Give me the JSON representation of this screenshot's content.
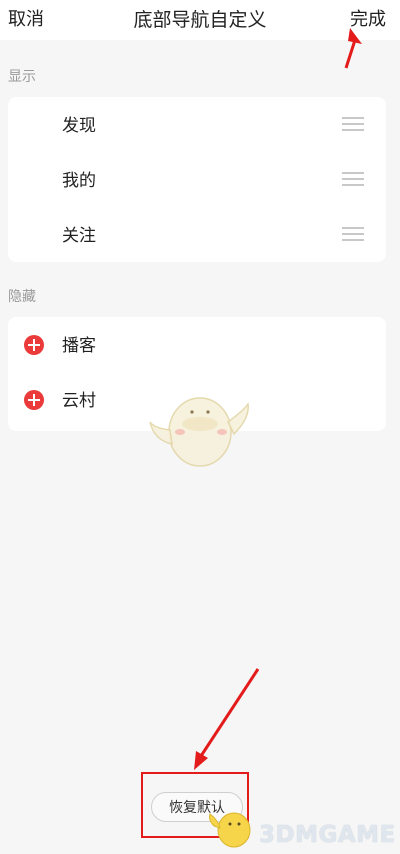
{
  "header": {
    "cancel_label": "取消",
    "title": "底部导航自定义",
    "done_label": "完成"
  },
  "visible_section": {
    "label": "显示",
    "items": [
      {
        "label": "发现",
        "icon": "drag-handle-icon"
      },
      {
        "label": "我的",
        "icon": "drag-handle-icon"
      },
      {
        "label": "关注",
        "icon": "drag-handle-icon"
      }
    ]
  },
  "hidden_section": {
    "label": "隐藏",
    "items": [
      {
        "label": "播客",
        "icon": "add-icon"
      },
      {
        "label": "云村",
        "icon": "add-icon"
      }
    ]
  },
  "footer": {
    "restore_label": "恢复默认"
  },
  "watermark": {
    "text": "3DMGAME"
  },
  "colors": {
    "background": "#f6f6f6",
    "card": "#ffffff",
    "accent_red": "#ea3a3a",
    "annotation_red": "#e31b1b",
    "muted_text": "#9a9a9a"
  }
}
